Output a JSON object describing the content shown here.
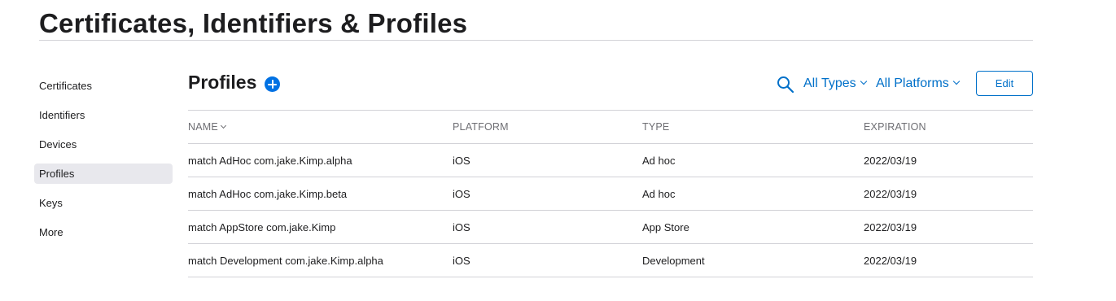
{
  "page": {
    "title": "Certificates, Identifiers & Profiles"
  },
  "sidebar": {
    "items": [
      {
        "label": "Certificates",
        "active": false
      },
      {
        "label": "Identifiers",
        "active": false
      },
      {
        "label": "Devices",
        "active": false
      },
      {
        "label": "Profiles",
        "active": true
      },
      {
        "label": "Keys",
        "active": false
      },
      {
        "label": "More",
        "active": false
      }
    ]
  },
  "section": {
    "title": "Profiles",
    "add_icon": "plus-circle-icon",
    "search_icon": "search-icon",
    "filter_types": "All Types",
    "filter_platforms": "All Platforms",
    "edit_label": "Edit"
  },
  "table": {
    "columns": [
      "NAME",
      "PLATFORM",
      "TYPE",
      "EXPIRATION"
    ],
    "rows": [
      {
        "name": "match AdHoc com.jake.Kimp.alpha",
        "platform": "iOS",
        "type": "Ad hoc",
        "expiration": "2022/03/19"
      },
      {
        "name": "match AdHoc com.jake.Kimp.beta",
        "platform": "iOS",
        "type": "Ad hoc",
        "expiration": "2022/03/19"
      },
      {
        "name": "match AppStore com.jake.Kimp",
        "platform": "iOS",
        "type": "App Store",
        "expiration": "2022/03/19"
      },
      {
        "name": "match Development com.jake.Kimp.alpha",
        "platform": "iOS",
        "type": "Development",
        "expiration": "2022/03/19"
      }
    ]
  },
  "colors": {
    "accent": "#0070c9",
    "add_button": "#0071e3",
    "active_item_bg": "#e8e8ed",
    "divider": "#d2d2d7"
  }
}
